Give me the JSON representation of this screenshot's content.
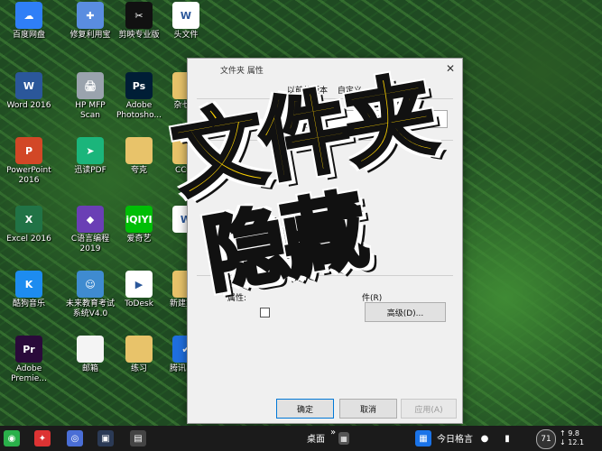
{
  "desktop_icons": [
    {
      "label": "百度网盘",
      "glyph": "☁",
      "color": "#2f7ff7",
      "icon": "cloud-icon"
    },
    {
      "label": "修复利用宝",
      "glyph": "✚",
      "color": "#5a8de0",
      "icon": "repair-icon"
    },
    {
      "label": "剪映专业版",
      "glyph": "✂",
      "color": "#111111",
      "icon": "scissors-icon"
    },
    {
      "label": "头文件",
      "glyph": "W",
      "color": "#ffffff",
      "icon": "word-doc-icon"
    },
    {
      "label": "Word 2016",
      "glyph": "W",
      "color": "#2b579a",
      "icon": "word-icon"
    },
    {
      "label": "HP MFP\nScan",
      "glyph": "🖨",
      "color": "#9aa3ad",
      "icon": "printer-icon"
    },
    {
      "label": "Adobe\nPhotosho...",
      "glyph": "Ps",
      "color": "#001e36",
      "icon": "photoshop-icon"
    },
    {
      "label": "杂七杂",
      "glyph": "",
      "color": "#e8c36a",
      "icon": "folder-icon"
    },
    {
      "label": "PowerPoint\n2016",
      "glyph": "P",
      "color": "#d24726",
      "icon": "powerpoint-icon"
    },
    {
      "label": "迅读PDF",
      "glyph": "➤",
      "color": "#1bb57b",
      "icon": "pdf-reader-icon"
    },
    {
      "label": "夸克",
      "glyph": "",
      "color": "#e8c36a",
      "icon": "folder-icon"
    },
    {
      "label": "CCtal",
      "glyph": "",
      "color": "#e8c36a",
      "icon": "folder-icon"
    },
    {
      "label": "Excel 2016",
      "glyph": "X",
      "color": "#217346",
      "icon": "excel-icon"
    },
    {
      "label": "C语言编程\n2019",
      "glyph": "◆",
      "color": "#6a3fb5",
      "icon": "visual-studio-icon"
    },
    {
      "label": "爱奇艺",
      "glyph": "iQIYI",
      "color": "#00be06",
      "icon": "iqiyi-icon"
    },
    {
      "label": "",
      "glyph": "W",
      "color": "#ffffff",
      "icon": "word-doc-icon"
    },
    {
      "label": "酷狗音乐",
      "glyph": "K",
      "color": "#1d8cf0",
      "icon": "kugou-icon"
    },
    {
      "label": "未来教育考试\n系统V4.0",
      "glyph": "☺",
      "color": "#3f8bd0",
      "icon": "exam-icon"
    },
    {
      "label": "ToDesk",
      "glyph": "▶",
      "color": "#ffffff",
      "icon": "todesk-icon"
    },
    {
      "label": "新建文件",
      "glyph": "",
      "color": "#e8c36a",
      "icon": "folder-icon"
    },
    {
      "label": "Adobe\nPremie...",
      "glyph": "Pr",
      "color": "#2a0a3a",
      "icon": "premiere-icon"
    },
    {
      "label": "邮箱",
      "glyph": "",
      "color": "#f4f4f4",
      "icon": "blank-file-icon"
    },
    {
      "label": "练习",
      "glyph": "",
      "color": "#e8c36a",
      "icon": "folder-icon"
    },
    {
      "label": "腾讯电脑",
      "glyph": "✔",
      "color": "#1f6fe0",
      "icon": "tencent-pc-icon"
    }
  ],
  "dialog": {
    "title": "文件夹 属性",
    "close": "✕",
    "tabs": [
      "以前的版本",
      "自定义"
    ],
    "attributes_label": "属性:",
    "archive_label": "件(R)",
    "advanced_button": "高级(D)...",
    "ok_button": "确定",
    "cancel_button": "取消",
    "apply_button": "应用(A)"
  },
  "overlay": {
    "line1": "文件夹",
    "line2": "隐藏"
  },
  "taskbar": {
    "desktop_label": "桌面",
    "weather_text": "今日格言",
    "badge": "71",
    "speed_up": "9.8",
    "speed_down": "12.1",
    "chevron": "»",
    "up_arrow": "↑",
    "down_arrow": "↓"
  }
}
